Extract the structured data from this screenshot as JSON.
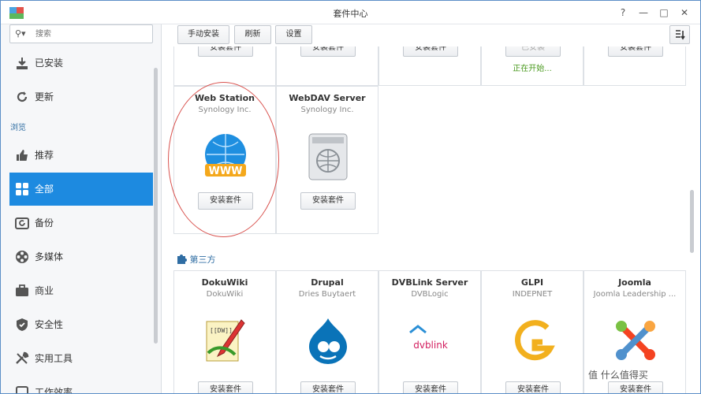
{
  "window": {
    "title": "套件中心"
  },
  "titlebar": {
    "help_label": "?",
    "minimize_label": "—",
    "maximize_label": "□",
    "close_label": "✕"
  },
  "search": {
    "placeholder": "搜索"
  },
  "sidebar": {
    "installed_label": "已安装",
    "updates_label": "更新",
    "browse_label": "浏览",
    "items": [
      {
        "label": "推荐"
      },
      {
        "label": "全部"
      },
      {
        "label": "备份"
      },
      {
        "label": "多媒体"
      },
      {
        "label": "商业"
      },
      {
        "label": "安全性"
      },
      {
        "label": "实用工具"
      },
      {
        "label": "工作效率"
      }
    ]
  },
  "toolbar": {
    "manual_install": "手动安装",
    "refresh": "刷新",
    "settings": "设置",
    "sort_icon": "sort-icon"
  },
  "top_row": {
    "buttons": [
      "安装套件",
      "安装套件",
      "安装套件",
      "已安装",
      "安装套件"
    ],
    "status": "正在开始..."
  },
  "packages": [
    {
      "name": "Web Station",
      "vendor": "Synology Inc.",
      "button": "安装套件"
    },
    {
      "name": "WebDAV Server",
      "vendor": "Synology Inc.",
      "button": "安装套件"
    }
  ],
  "third_party": {
    "label": "第三方",
    "packages": [
      {
        "name": "DokuWiki",
        "vendor": "DokuWiki",
        "button": "安装套件"
      },
      {
        "name": "Drupal",
        "vendor": "Dries Buytaert",
        "button": "安装套件"
      },
      {
        "name": "DVBLink Server",
        "vendor": "DVBLogic",
        "button": "安装套件"
      },
      {
        "name": "GLPI",
        "vendor": "INDEPNET",
        "button": "安装套件"
      },
      {
        "name": "Joomla",
        "vendor": "Joomla Leadership ...",
        "button": "安装套件"
      }
    ]
  },
  "logo_text": {
    "www": "WWW",
    "dvblink": "dvblink",
    "doku": "[[DW]]"
  },
  "watermark": "值 什么值得买"
}
